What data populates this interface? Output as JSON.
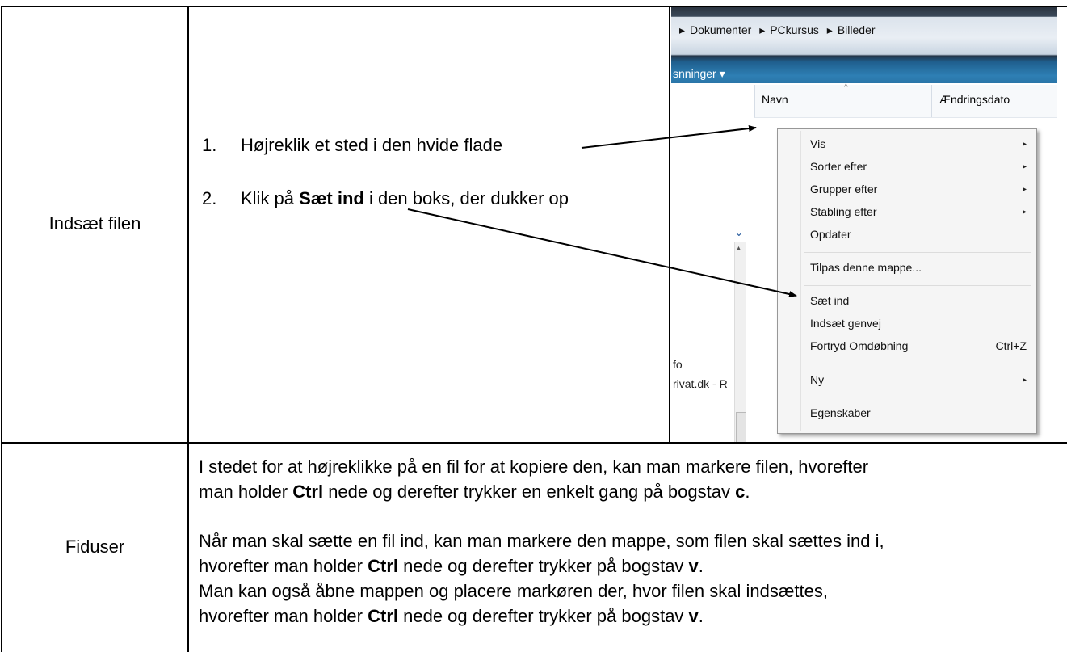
{
  "row1": {
    "label": "Indsæt filen",
    "step1": {
      "num": "1.",
      "text": "Højreklik et sted i den hvide flade"
    },
    "step2": {
      "num": "2.",
      "pre": "Klik på ",
      "bold": "Sæt ind",
      "post": " i den boks, der dukker op"
    }
  },
  "screenshot": {
    "breadcrumb": [
      "Dokumenter",
      "PCkursus",
      "Billeder"
    ],
    "toolbar_label": "snninger",
    "col_name": "Navn",
    "col_date": "Ændringsdato",
    "left_items": [
      "fo",
      "rivat.dk - R"
    ],
    "context_menu": {
      "items": [
        {
          "label": "Vis",
          "submenu": true
        },
        {
          "label": "Sorter efter",
          "submenu": true
        },
        {
          "label": "Grupper efter",
          "submenu": true
        },
        {
          "label": "Stabling efter",
          "submenu": true
        },
        {
          "label": "Opdater"
        },
        {
          "label": "Tilpas denne mappe..."
        },
        {
          "label": "Sæt ind"
        },
        {
          "label": "Indsæt genvej"
        },
        {
          "label": "Fortryd Omdøbning",
          "shortcut": "Ctrl+Z"
        },
        {
          "label": "Ny",
          "submenu": true
        },
        {
          "label": "Egenskaber"
        }
      ]
    }
  },
  "row2": {
    "label": "Fiduser",
    "p1_l1": "I stedet for at højreklikke på en fil for at kopiere den, kan man markere filen, hvorefter",
    "p1_l2_pre": "man holder ",
    "p1_l2_b1": "Ctrl",
    "p1_l2_mid": " nede og derefter trykker en enkelt gang på bogstav ",
    "p1_l2_b2": "c",
    "p1_l2_post": ".",
    "p2_l1": "Når man skal sætte en fil ind, kan man markere den mappe, som filen skal sættes ind i,",
    "p2_l2_pre": "hvorefter man holder ",
    "p2_l2_b1": "Ctrl",
    "p2_l2_mid": " nede og derefter trykker på bogstav ",
    "p2_l2_b2": "v",
    "p2_l2_post": ".",
    "p3_l1": "Man kan også åbne mappen og placere markøren der, hvor filen skal indsættes,",
    "p3_l2_pre": "hvorefter man holder ",
    "p3_l2_b1": "Ctrl",
    "p3_l2_mid": " nede og derefter trykker på bogstav ",
    "p3_l2_b2": "v",
    "p3_l2_post": "."
  }
}
